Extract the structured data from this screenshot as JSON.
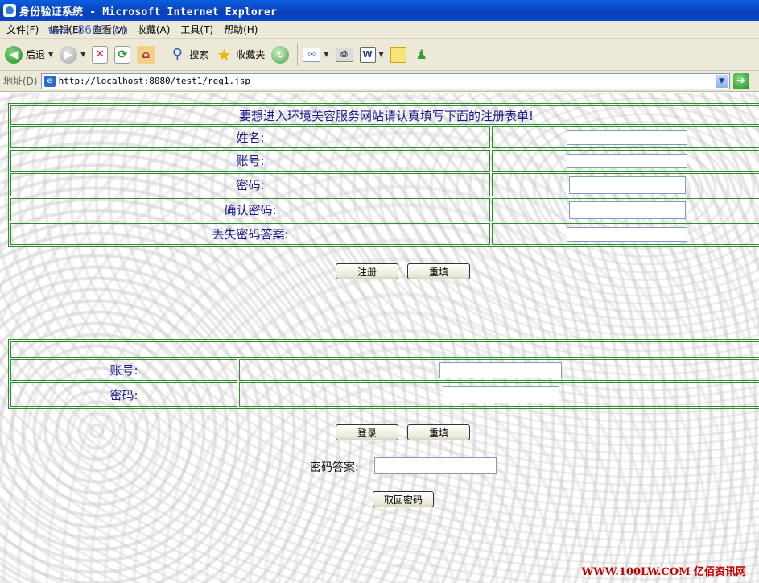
{
  "window": {
    "title": "身份验证系统 - Microsoft Internet Explorer"
  },
  "menu": [
    "文件(F)",
    "编辑(E)",
    "查看(V)",
    "收藏(A)",
    "工具(T)",
    "帮助(H)"
  ],
  "menu_watermark": "www.8660.cn",
  "toolbar": {
    "back": "后退",
    "search": "搜索",
    "favorites": "收藏夹"
  },
  "address": {
    "label": "地址(D)",
    "url": "http://localhost:8080/test1/reg1.jsp"
  },
  "register": {
    "header": "要想进入环境美容服务网站请认真填写下面的注册表单!",
    "fields": [
      {
        "label": "姓名:",
        "value": ""
      },
      {
        "label": "账号:",
        "value": ""
      },
      {
        "label": "密码:",
        "value": ""
      },
      {
        "label": "确认密码:",
        "value": ""
      },
      {
        "label": "丢失密码答案:",
        "value": ""
      }
    ],
    "submit": "注册",
    "reset": "重填"
  },
  "login": {
    "fields": [
      {
        "label": "账号:",
        "value": ""
      },
      {
        "label": "密码:",
        "value": ""
      }
    ],
    "submit": "登录",
    "reset": "重填"
  },
  "recover": {
    "label": "密码答案:",
    "button": "取回密码",
    "value": ""
  },
  "footer_watermark": "WWW.100LW.COM 亿佰资讯网"
}
